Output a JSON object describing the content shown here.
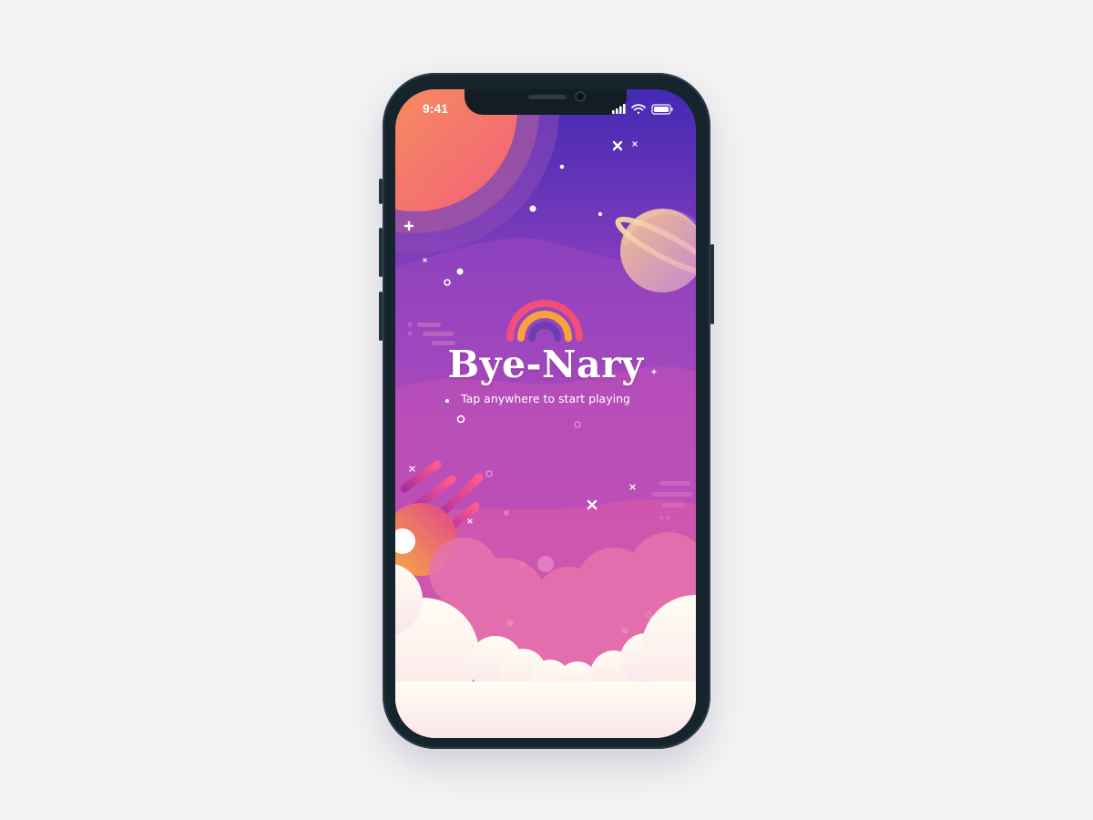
{
  "status_bar": {
    "time": "9:41",
    "icons": [
      "signal-icon",
      "wifi-icon",
      "battery-icon"
    ]
  },
  "app": {
    "title": "Bye-Nary",
    "subtitle": "Tap anywhere to start playing",
    "logo_icon": "rainbow-icon"
  },
  "theme": {
    "sky_top": "#4b2db3",
    "sky_mid": "#a24bbb",
    "sky_bottom": "#e15fa2",
    "cloud": "#fdf7f0",
    "rainbow_outer": "#f14f79",
    "rainbow_middle": "#f8a23a",
    "rainbow_inner": "#6a3fb1"
  }
}
